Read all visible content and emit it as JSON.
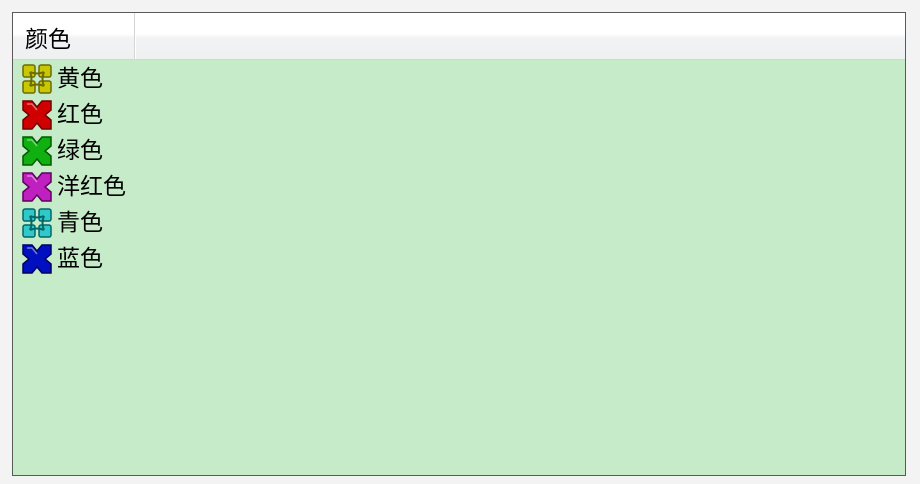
{
  "listview": {
    "column_header": "颜色",
    "items": [
      {
        "label": "黄色",
        "icon": "yellow-color-icon",
        "color": "#c8c800",
        "dark": "#6b6b00",
        "style": "split"
      },
      {
        "label": "红色",
        "icon": "red-color-icon",
        "color": "#d00000",
        "dark": "#700000",
        "style": "cross"
      },
      {
        "label": "绿色",
        "icon": "green-color-icon",
        "color": "#10b010",
        "dark": "#005a00",
        "style": "cross"
      },
      {
        "label": "洋红色",
        "icon": "magenta-color-icon",
        "color": "#c020c0",
        "dark": "#600060",
        "style": "cross"
      },
      {
        "label": "青色",
        "icon": "cyan-color-icon",
        "color": "#30c8c8",
        "dark": "#006868",
        "style": "split"
      },
      {
        "label": "蓝色",
        "icon": "blue-color-icon",
        "color": "#0010c0",
        "dark": "#000060",
        "style": "cross"
      }
    ]
  }
}
